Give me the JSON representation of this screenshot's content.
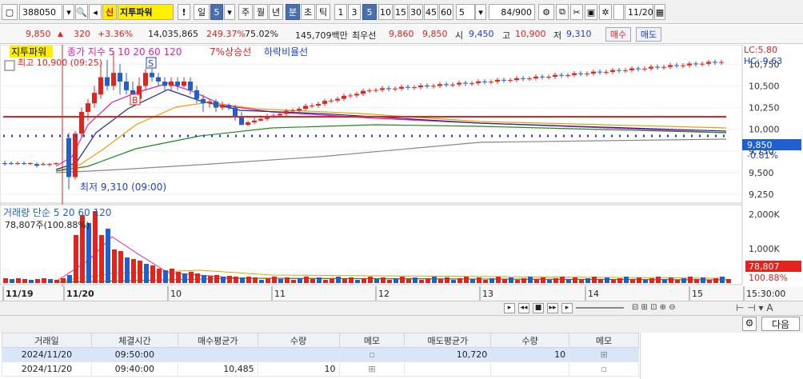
{
  "toolbar": {
    "code": "388050",
    "badge": "신",
    "name": "지투파워",
    "alert": "!",
    "period_sel": "일",
    "period_num": "5",
    "periods": [
      "주",
      "월",
      "년",
      "분",
      "초",
      "틱"
    ],
    "minutes": [
      "1",
      "3",
      "5",
      "10",
      "15",
      "30",
      "45",
      "60"
    ],
    "interval_value": "5",
    "count_display": "84/900",
    "date": "11/20"
  },
  "quote": {
    "price": "9,850",
    "change": "320",
    "change_pct": "+3.36%",
    "volume": "14,035,865",
    "vol_ratio": "249.37%",
    "rate": "75.02%",
    "amount": "145,709백만",
    "best_label": "최우선",
    "best_sell": "9,860",
    "best_buy": "9,850",
    "open_label": "시",
    "open": "9,450",
    "high_label": "고",
    "high": "10,900",
    "low_label": "저",
    "low": "9,310",
    "buy_btn": "매수",
    "sell_btn": "매도"
  },
  "chart_labels": {
    "name_tag": "지투파워",
    "indicator_line": "종가 지수 5 10 20 60 120",
    "ma5": "5",
    "ma10": "10",
    "ma20": "20",
    "ma60": "60",
    "ma120": "120",
    "up_line": "7%상승선",
    "down_line": "하락비율선",
    "high_annot": "최고 10,900 (09:25)",
    "low_annot": "최저 9,310 (09:00)",
    "lc": "LC:5.80",
    "hc": "HC:-9.63",
    "price_now": "9,850",
    "price_pct": "-0.81%",
    "vol_title": "거래량 단순 5 20 60 120",
    "vol_now": "78,807주(100.88%)",
    "vol_badge": "78,807",
    "vol_pct": "100.88%",
    "marker_s": "S",
    "marker_b": "B"
  },
  "chart_data": {
    "type": "candlestick",
    "y_ticks": [
      "10,750",
      "10,500",
      "10,250",
      "10,000",
      "9,750",
      "9,500",
      "9,250"
    ],
    "ylim": [
      9150,
      10900
    ],
    "vol_ticks": [
      "2,000K",
      "1,000K"
    ],
    "x_labels": [
      "11/19",
      "11/20",
      "10",
      "11",
      "12",
      "13",
      "14",
      "15",
      "15:30:00"
    ],
    "colors": {
      "up": "#e1241e",
      "down": "#1f5fd0",
      "ma5": "#e020b0",
      "ma10": "#1a2a9a",
      "ma20": "#e8a000",
      "ma60": "#208a20",
      "ma120": "#888888"
    }
  },
  "table": {
    "headers": [
      "거래일",
      "체결시간",
      "매수평균가",
      "수량",
      "메모",
      "매도평균가",
      "수량",
      "메모"
    ],
    "rows": [
      {
        "date": "2024/11/20",
        "time": "09:50:00",
        "buy_avg": "",
        "buy_qty": "",
        "sell_avg": "10,720",
        "sell_qty": "10"
      },
      {
        "date": "2024/11/20",
        "time": "09:40:00",
        "buy_avg": "10,485",
        "buy_qty": "10",
        "sell_avg": "",
        "sell_qty": ""
      }
    ],
    "next_btn": "다음"
  }
}
